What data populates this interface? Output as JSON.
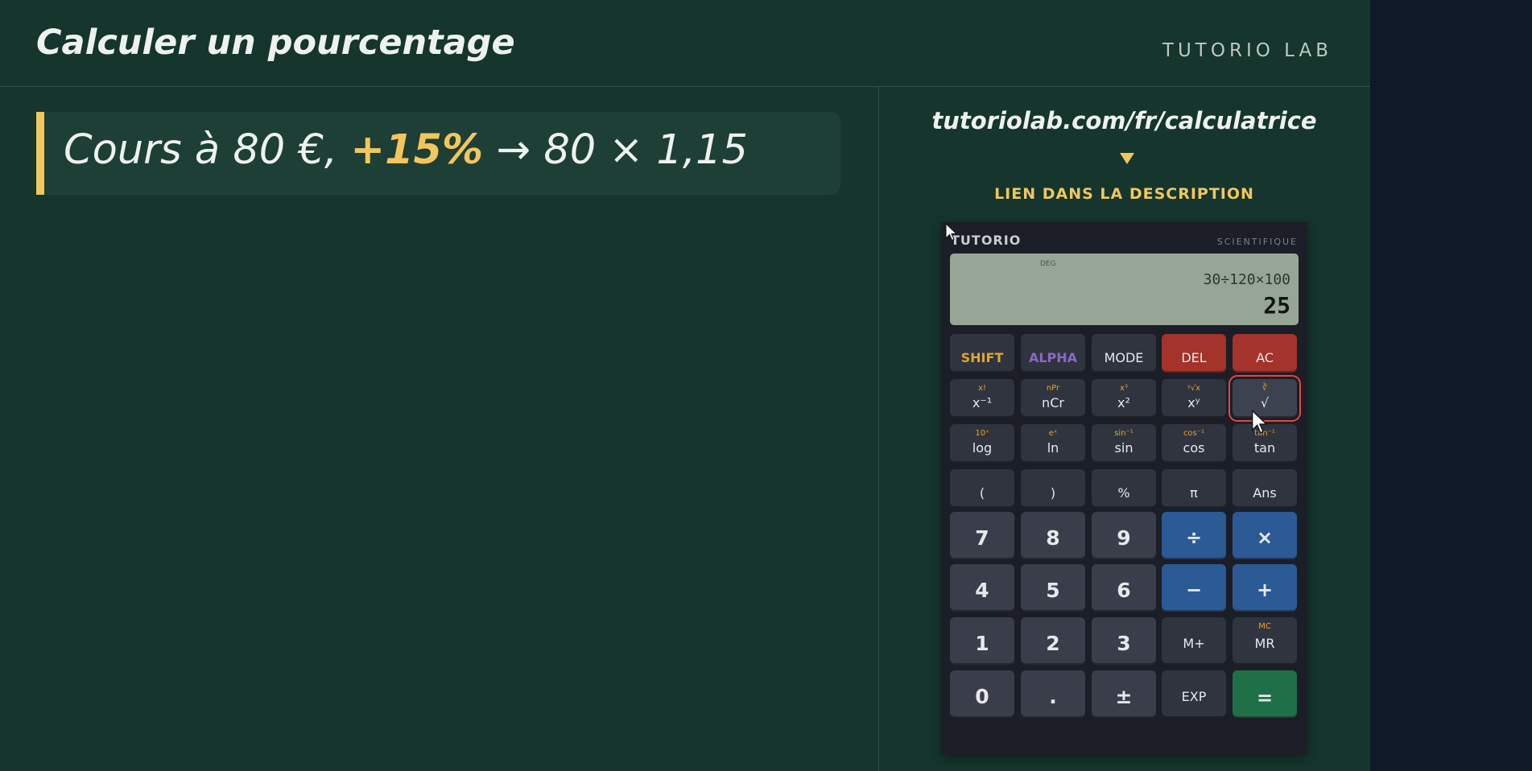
{
  "header": {
    "title": "Calculer un pourcentage",
    "brand": "TUTORIO LAB"
  },
  "formula": {
    "part1": "Cours à 80 €,",
    "highlight": "+15%",
    "arrow": "→",
    "part2": "80 × 1,15"
  },
  "promo": {
    "url": "tutoriolab.com/fr/calculatrice",
    "link_text": "LIEN DANS LA DESCRIPTION"
  },
  "calculator": {
    "brand": "TUTORIO",
    "mode": "SCIENTIFIQUE",
    "angle_unit": "DEG",
    "expression": "30÷120×100",
    "result": "25",
    "rows": [
      [
        {
          "main": "SHIFT"
        },
        {
          "main": "ALPHA"
        },
        {
          "main": "MODE"
        },
        {
          "main": "DEL"
        },
        {
          "main": "AC"
        }
      ],
      [
        {
          "main": "x⁻¹",
          "sec": "x!"
        },
        {
          "main": "nCr",
          "sec": "nPr"
        },
        {
          "main": "x²",
          "sec": "x³"
        },
        {
          "main": "xʸ",
          "sec": "ʸ√x"
        },
        {
          "main": "√",
          "sec": "∛"
        }
      ],
      [
        {
          "main": "log",
          "sec": "10ˣ"
        },
        {
          "main": "ln",
          "sec": "eˣ"
        },
        {
          "main": "sin",
          "sec": "sin⁻¹"
        },
        {
          "main": "cos",
          "sec": "cos⁻¹"
        },
        {
          "main": "tan",
          "sec": "tan⁻¹"
        }
      ],
      [
        {
          "main": "("
        },
        {
          "main": ")"
        },
        {
          "main": "%"
        },
        {
          "main": "π"
        },
        {
          "main": "Ans"
        }
      ],
      [
        {
          "main": "7"
        },
        {
          "main": "8"
        },
        {
          "main": "9"
        },
        {
          "main": "÷"
        },
        {
          "main": "×"
        }
      ],
      [
        {
          "main": "4"
        },
        {
          "main": "5"
        },
        {
          "main": "6"
        },
        {
          "main": "−"
        },
        {
          "main": "+"
        }
      ],
      [
        {
          "main": "1"
        },
        {
          "main": "2"
        },
        {
          "main": "3"
        },
        {
          "main": "M+"
        },
        {
          "main": "MR",
          "sec": "MC"
        }
      ],
      [
        {
          "main": "0"
        },
        {
          "main": "."
        },
        {
          "main": "±"
        },
        {
          "main": "EXP"
        },
        {
          "main": "="
        }
      ]
    ]
  },
  "colors": {
    "background": "#15352d",
    "accent": "#f2c65c",
    "operator": "#2c5a94",
    "danger": "#a3332b",
    "equals": "#1f7048"
  }
}
